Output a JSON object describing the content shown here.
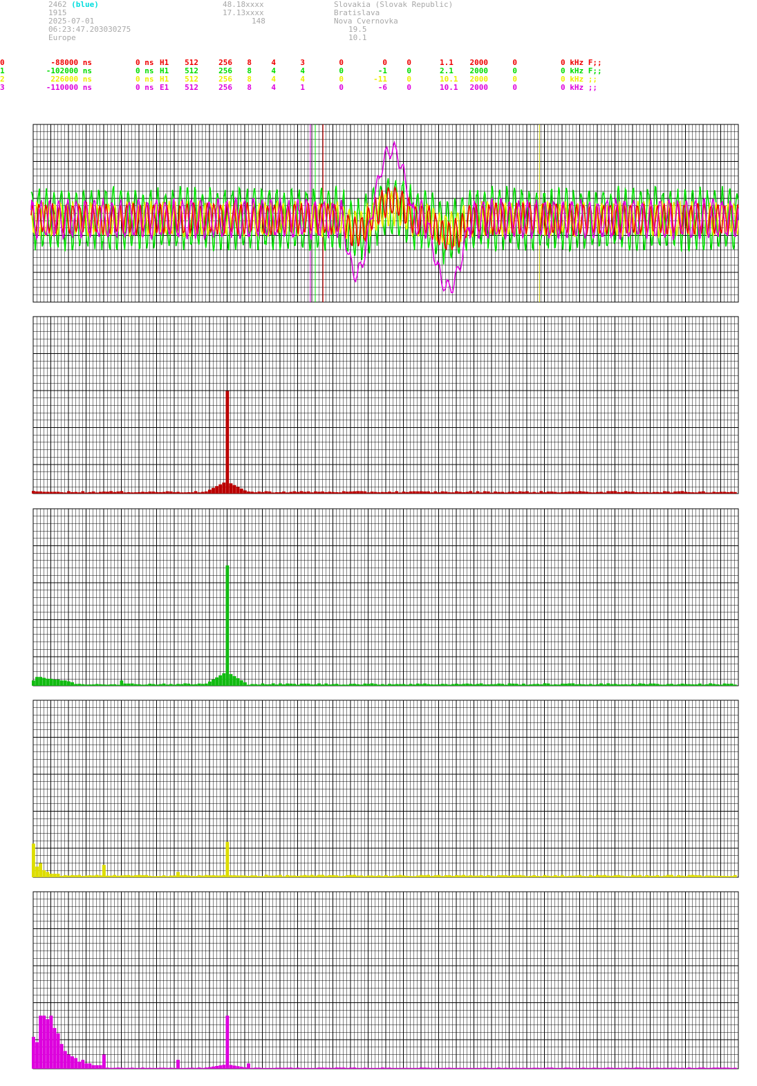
{
  "header": {
    "station_id": "2462",
    "station_color": "(blue)",
    "year": "1915",
    "date": "2025-07-01",
    "time": "06:23:47.203030275",
    "continent": "Europe",
    "lat": "48.18xxxx",
    "lon": "17.13xxxx",
    "alt": "148",
    "country": "Slovakia (Slovak Republic)",
    "region": "Bratislava",
    "city": "Nova Cvernovka",
    "val1": "19.5",
    "val2": "10.1"
  },
  "channels": [
    {
      "id": "0",
      "offset": "-88000 ns",
      "delay": "0 ns",
      "sensor": "H1",
      "n1": "512",
      "n2": "256",
      "n3": "8",
      "n4": "4",
      "n5": "3",
      "n6": "0",
      "n7": "0",
      "n8": "0",
      "gain": "1.1",
      "rate": "2000",
      "n9": "0",
      "tail": "0 kHz F;;",
      "color": "#ee0000"
    },
    {
      "id": "1",
      "offset": "-102000 ns",
      "delay": "0 ns",
      "sensor": "H1",
      "n1": "512",
      "n2": "256",
      "n3": "8",
      "n4": "4",
      "n5": "4",
      "n6": "0",
      "n7": "-1",
      "n8": "0",
      "gain": "2.1",
      "rate": "2000",
      "n9": "0",
      "tail": "0 kHz F;;",
      "color": "#00dd00"
    },
    {
      "id": "2",
      "offset": "226000 ns",
      "delay": "0 ns",
      "sensor": "H1",
      "n1": "512",
      "n2": "256",
      "n3": "8",
      "n4": "4",
      "n5": "4",
      "n6": "0",
      "n7": "-11",
      "n8": "0",
      "gain": "10.1",
      "rate": "2000",
      "n9": "0",
      "tail": "0 kHz ;;",
      "color": "#eeee00"
    },
    {
      "id": "3",
      "offset": "-110000 ns",
      "delay": "0 ns",
      "sensor": "E1",
      "n1": "512",
      "n2": "256",
      "n3": "8",
      "n4": "4",
      "n5": "1",
      "n6": "0",
      "n7": "-6",
      "n8": "0",
      "gain": "10.1",
      "rate": "2000",
      "n9": "0",
      "tail": "0 kHz ;;",
      "color": "#dd00dd"
    }
  ],
  "chart_data": [
    {
      "type": "line",
      "description_id": "waveform",
      "x_range": [
        0,
        1
      ],
      "y_range": [
        -1,
        1
      ],
      "grid": true,
      "series": [
        {
          "color": "#ee0000",
          "amp": 0.16,
          "period": 0.0095,
          "phase": 0.3
        },
        {
          "color": "#00dd00",
          "amp": 0.32,
          "period": 0.0105,
          "phase": 1.1
        },
        {
          "color": "#eeee00",
          "amp": 0.18,
          "period": 0.0085,
          "phase": 2.0
        },
        {
          "color": "#dd00dd",
          "amp": 0.2,
          "period": 0.0125,
          "phase": 0.7
        }
      ],
      "event": {
        "start": 0.44,
        "peak_pos_start": 0.48,
        "peak_pos_end": 0.54,
        "peak_neg_start": 0.56,
        "peak_neg_end": 0.62,
        "amp": 0.78
      },
      "markers": [
        {
          "x": 0.393,
          "color": "#dd00dd"
        },
        {
          "x": 0.396,
          "color": "#777777"
        },
        {
          "x": 0.4,
          "color": "#00dd00"
        },
        {
          "x": 0.411,
          "color": "#ee0000"
        },
        {
          "x": 0.718,
          "color": "#cccc00"
        }
      ]
    },
    {
      "type": "bar",
      "series_color": "#bb0000",
      "peak_bin": 0.274,
      "peak_value": 0.58,
      "shoulder": 0.06,
      "floor": 0.01,
      "low_freq": [
        0.015,
        0.012,
        0.012,
        0.01,
        0.01,
        0.01,
        0.01,
        0.01
      ],
      "extra": []
    },
    {
      "type": "bar",
      "series_color": "#11bb11",
      "peak_bin": 0.274,
      "peak_value": 0.68,
      "shoulder": 0.07,
      "floor": 0.01,
      "low_freq": [
        0.03,
        0.05,
        0.05,
        0.045,
        0.04,
        0.04,
        0.035,
        0.035,
        0.03,
        0.03,
        0.025,
        0.02
      ],
      "extra": [
        {
          "x": 0.125,
          "v": 0.03
        }
      ]
    },
    {
      "type": "bar",
      "series_color": "#dddd00",
      "peak_bin": 0.274,
      "peak_value": 0.2,
      "shoulder": 0.0,
      "floor": 0.01,
      "low_freq": [
        0.19,
        0.06,
        0.08,
        0.04,
        0.03,
        0.02,
        0.02,
        0.02
      ],
      "extra": [
        {
          "x": 0.101,
          "v": 0.07
        },
        {
          "x": 0.205,
          "v": 0.03
        }
      ]
    },
    {
      "type": "bar",
      "series_color": "#dd00dd",
      "peak_bin": 0.274,
      "peak_value": 0.3,
      "shoulder": 0.02,
      "floor": 0.005,
      "low_freq": [
        0.18,
        0.15,
        0.3,
        0.3,
        0.28,
        0.3,
        0.23,
        0.2,
        0.14,
        0.1,
        0.08,
        0.07,
        0.06,
        0.04,
        0.05,
        0.03,
        0.03,
        0.02,
        0.02,
        0.02
      ],
      "extra": [
        {
          "x": 0.101,
          "v": 0.08
        },
        {
          "x": 0.205,
          "v": 0.05
        },
        {
          "x": 0.303,
          "v": 0.03
        }
      ]
    }
  ]
}
